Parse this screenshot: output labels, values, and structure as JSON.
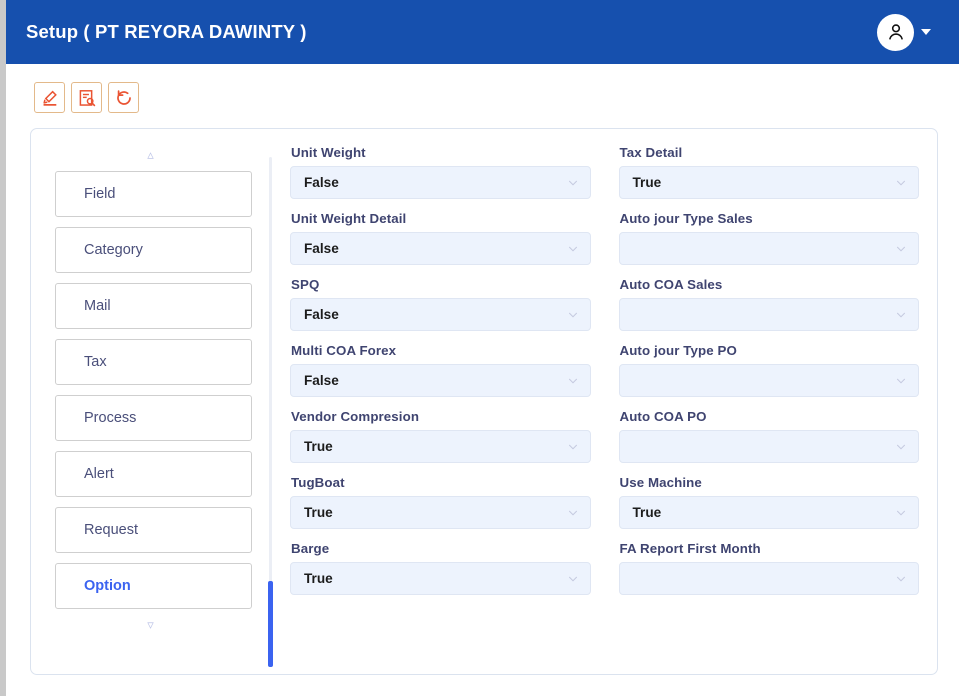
{
  "header": {
    "title": "Setup ( PT REYORA DAWINTY )",
    "avatar_icon": "user-icon",
    "caret_icon": "caret-down-icon",
    "background_color": "#1650ae"
  },
  "toolbar": {
    "buttons": [
      {
        "name": "edit-button",
        "icon": "pencil-edit-icon"
      },
      {
        "name": "view-detail-button",
        "icon": "document-search-icon"
      },
      {
        "name": "refresh-button",
        "icon": "refresh-undo-icon"
      }
    ],
    "icon_color": "#ea5433",
    "border_color": "#e3b98a"
  },
  "sidebar": {
    "scroll_up_icon": "chevron-up-icon",
    "scroll_down_icon": "chevron-down-icon",
    "active_item": "Option",
    "active_color": "#3b63f0",
    "items": [
      {
        "label": "Field"
      },
      {
        "label": "Category"
      },
      {
        "label": "Mail"
      },
      {
        "label": "Tax"
      },
      {
        "label": "Process"
      },
      {
        "label": "Alert"
      },
      {
        "label": "Request"
      },
      {
        "label": "Option"
      }
    ]
  },
  "form": {
    "chevron_icon": "chevron-down-icon",
    "left_column": [
      {
        "label": "Unit Weight",
        "value": "False"
      },
      {
        "label": "Unit Weight Detail",
        "value": "False"
      },
      {
        "label": "SPQ",
        "value": "False"
      },
      {
        "label": "Multi COA Forex",
        "value": "False"
      },
      {
        "label": "Vendor Compresion",
        "value": "True"
      },
      {
        "label": "TugBoat",
        "value": "True"
      },
      {
        "label": "Barge",
        "value": "True"
      }
    ],
    "right_column": [
      {
        "label": "Tax Detail",
        "value": "True"
      },
      {
        "label": "Auto jour Type Sales",
        "value": ""
      },
      {
        "label": "Auto COA Sales",
        "value": ""
      },
      {
        "label": "Auto jour Type PO",
        "value": ""
      },
      {
        "label": "Auto COA PO",
        "value": ""
      },
      {
        "label": "Use Machine",
        "value": "True"
      },
      {
        "label": "FA Report First Month",
        "value": ""
      }
    ]
  }
}
